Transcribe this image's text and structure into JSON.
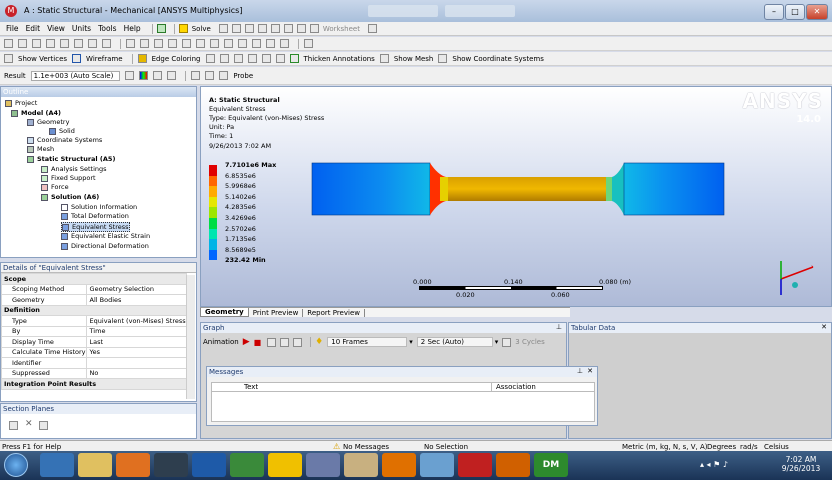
{
  "window": {
    "title": "A : Static Structural - Mechanical [ANSYS Multiphysics]",
    "minimize": "–",
    "maximize": "□",
    "close": "✕"
  },
  "menu": [
    "File",
    "Edit",
    "View",
    "Units",
    "Tools",
    "Help"
  ],
  "toolbar1": {
    "solve": "Solve",
    "worksheet": "Worksheet"
  },
  "toolbar2": {
    "show_vertices": "Show Vertices",
    "wireframe": "Wireframe",
    "edge_coloring": "Edge Coloring",
    "thicken": "Thicken Annotations",
    "show_mesh": "Show Mesh",
    "show_coord": "Show Coordinate Systems"
  },
  "toolbar3": {
    "result_label": "Result",
    "scale": "1.1e+003 (Auto Scale)",
    "probe": "Probe"
  },
  "outline": {
    "title": "Outline",
    "items": [
      "Project",
      "Model (A4)",
      "Geometry",
      "Solid",
      "Coordinate Systems",
      "Mesh",
      "Static Structural (A5)",
      "Analysis Settings",
      "Fixed Support",
      "Force",
      "Solution (A6)",
      "Solution Information",
      "Total Deformation",
      "Equivalent Stress",
      "Equivalent Elastic Strain",
      "Directional Deformation"
    ]
  },
  "details": {
    "title": "Details of \"Equivalent Stress\"",
    "rows": [
      {
        "section": "Scope"
      },
      {
        "k": "Scoping Method",
        "v": "Geometry Selection"
      },
      {
        "k": "Geometry",
        "v": "All Bodies"
      },
      {
        "section": "Definition"
      },
      {
        "k": "Type",
        "v": "Equivalent (von-Mises) Stress"
      },
      {
        "k": "By",
        "v": "Time"
      },
      {
        "k": "Display Time",
        "v": "Last"
      },
      {
        "k": "Calculate Time History",
        "v": "Yes"
      },
      {
        "k": "Identifier",
        "v": ""
      },
      {
        "k": "Suppressed",
        "v": "No"
      },
      {
        "section": "Integration Point Results"
      }
    ]
  },
  "section_planes": {
    "title": "Section Planes"
  },
  "viewport": {
    "header": [
      "A: Static Structural",
      "Equivalent Stress",
      "Type: Equivalent (von-Mises) Stress",
      "Unit: Pa",
      "Time: 1",
      "9/26/2013 7:02 AM"
    ],
    "logo": "ANSYS",
    "version": "14.0",
    "legend": [
      {
        "label": "7.7101e6 Max",
        "color": "#e00000"
      },
      {
        "label": "6.8535e6",
        "color": "#ff6600"
      },
      {
        "label": "5.9968e6",
        "color": "#ffaa00"
      },
      {
        "label": "5.1402e6",
        "color": "#e6e600"
      },
      {
        "label": "4.2835e6",
        "color": "#9ee600"
      },
      {
        "label": "3.4269e6",
        "color": "#00dd44"
      },
      {
        "label": "2.5702e6",
        "color": "#00e6b0"
      },
      {
        "label": "1.7135e6",
        "color": "#00b4e6"
      },
      {
        "label": "8.5689e5",
        "color": "#0066ff"
      },
      {
        "label": "232.42 Min",
        "color": "#0000cc"
      }
    ],
    "scale_top": [
      "0.000",
      "0.140",
      "0.080 (m)"
    ],
    "scale_bottom": [
      "0.020",
      "0.060"
    ]
  },
  "tabs": [
    "Geometry",
    "Print Preview",
    "Report Preview"
  ],
  "graph": {
    "title": "Graph",
    "animation": "Animation",
    "frames": "10 Frames",
    "duration": "2 Sec (Auto)",
    "cycles": "3 Cycles"
  },
  "tabular": {
    "title": "Tabular Data"
  },
  "messages": {
    "title": "Messages",
    "col_text": "Text",
    "col_assoc": "Association"
  },
  "status": {
    "help": "Press F1 for Help",
    "messages": "No Messages",
    "selection": "No Selection",
    "units": "Metric (m, kg, N, s, V, A)",
    "angle": "Degrees",
    "rate": "rad/s",
    "temp": "Celsius"
  },
  "taskbar": {
    "time": "7:02 AM",
    "date": "9/26/2013",
    "dm_label": "DM"
  }
}
